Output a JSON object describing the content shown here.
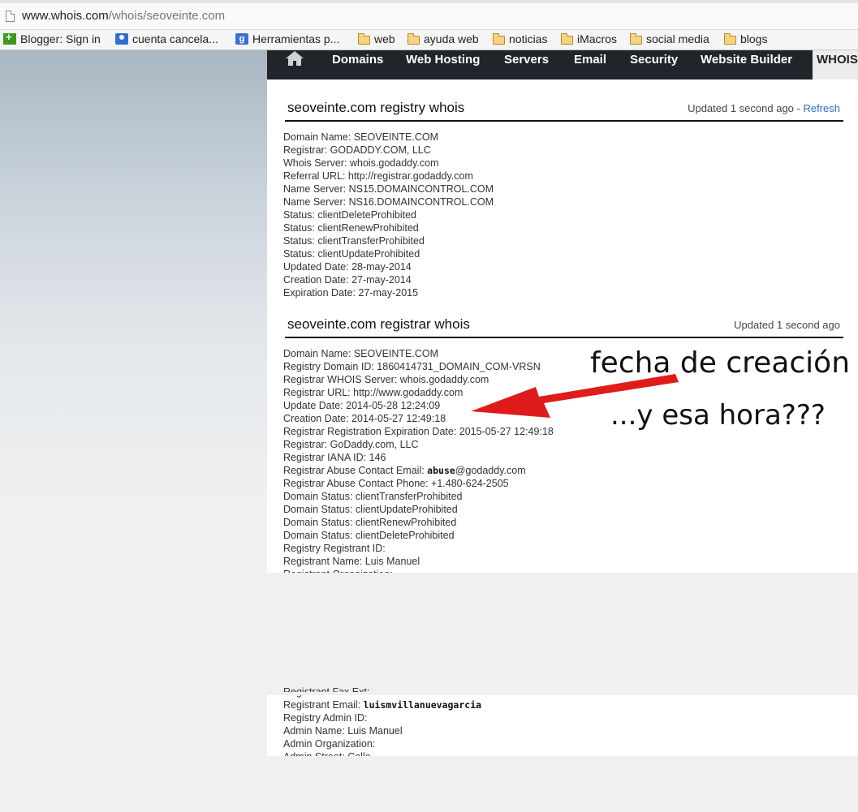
{
  "browser": {
    "url_host": "www.whois.com",
    "url_path": "/whois/seoveinte.com",
    "bookmarks": [
      {
        "icon": "blogger-icon",
        "label": "Blogger: Sign in"
      },
      {
        "icon": "person-icon",
        "label": "cuenta cancela..."
      },
      {
        "icon": "google-plus-icon",
        "label": "Herramientas p..."
      },
      {
        "icon": "folder-icon",
        "label": "web"
      },
      {
        "icon": "folder-icon",
        "label": "ayuda web"
      },
      {
        "icon": "folder-icon",
        "label": "noticias"
      },
      {
        "icon": "folder-icon",
        "label": "iMacros"
      },
      {
        "icon": "folder-icon",
        "label": "social media"
      },
      {
        "icon": "folder-icon",
        "label": "blogs"
      }
    ]
  },
  "nav": {
    "home_icon": "home-icon",
    "items": [
      "Domains",
      "Web Hosting",
      "Servers",
      "Email",
      "Security",
      "Website Builder",
      "WHOIS"
    ]
  },
  "registry": {
    "title": "seoveinte.com registry whois",
    "updated": "Updated 1 second ago - ",
    "refresh": "Refresh",
    "lines": [
      "Domain Name: SEOVEINTE.COM",
      "Registrar: GODADDY.COM, LLC",
      "Whois Server: whois.godaddy.com",
      "Referral URL: http://registrar.godaddy.com",
      "Name Server: NS15.DOMAINCONTROL.COM",
      "Name Server: NS16.DOMAINCONTROL.COM",
      "Status: clientDeleteProhibited",
      "Status: clientRenewProhibited",
      "Status: clientTransferProhibited",
      "Status: clientUpdateProhibited",
      "Updated Date: 28-may-2014",
      "Creation Date: 27-may-2014",
      "Expiration Date: 27-may-2015"
    ]
  },
  "registrar": {
    "title": "seoveinte.com registrar whois",
    "updated": "Updated 1 second ago",
    "lines": [
      "Domain Name: SEOVEINTE.COM",
      "Registry Domain ID: 1860414731_DOMAIN_COM-VRSN",
      "Registrar WHOIS Server: whois.godaddy.com",
      "Registrar URL: http://www.godaddy.com",
      "Update Date: 2014-05-28 12:24:09",
      "Creation Date: 2014-05-27 12:49:18",
      "Registrar Registration Expiration Date: 2015-05-27 12:49:18",
      "Registrar: GoDaddy.com, LLC",
      "Registrar IANA ID: 146"
    ],
    "abuse_email_label": "Registrar Abuse Contact Email: ",
    "abuse_email_user": "abuse",
    "abuse_email_domain": "@godaddy.com",
    "lines2": [
      "Registrar Abuse Contact Phone: +1.480-624-2505",
      "Domain Status: clientTransferProhibited",
      "Domain Status: clientUpdateProhibited",
      "Domain Status: clientRenewProhibited",
      "Domain Status: clientDeleteProhibited",
      "Registry Registrant ID:",
      "Registrant Name: Luis Manuel"
    ],
    "partial_top": "Registrant Organization:",
    "partial_fax": "Registrant Fax Ext:",
    "email_label": "Registrant Email: ",
    "email_value": "luismvillanuevagarcia",
    "lines3": [
      "Registry Admin ID:",
      "Admin Name: Luis Manuel",
      "Admin Organization:"
    ],
    "partial_bottom": "Admin Street: Calle"
  },
  "annotation": {
    "line1": "fecha de creación",
    "line2": "...y esa hora???",
    "arrow_color": "#e01b1b"
  }
}
